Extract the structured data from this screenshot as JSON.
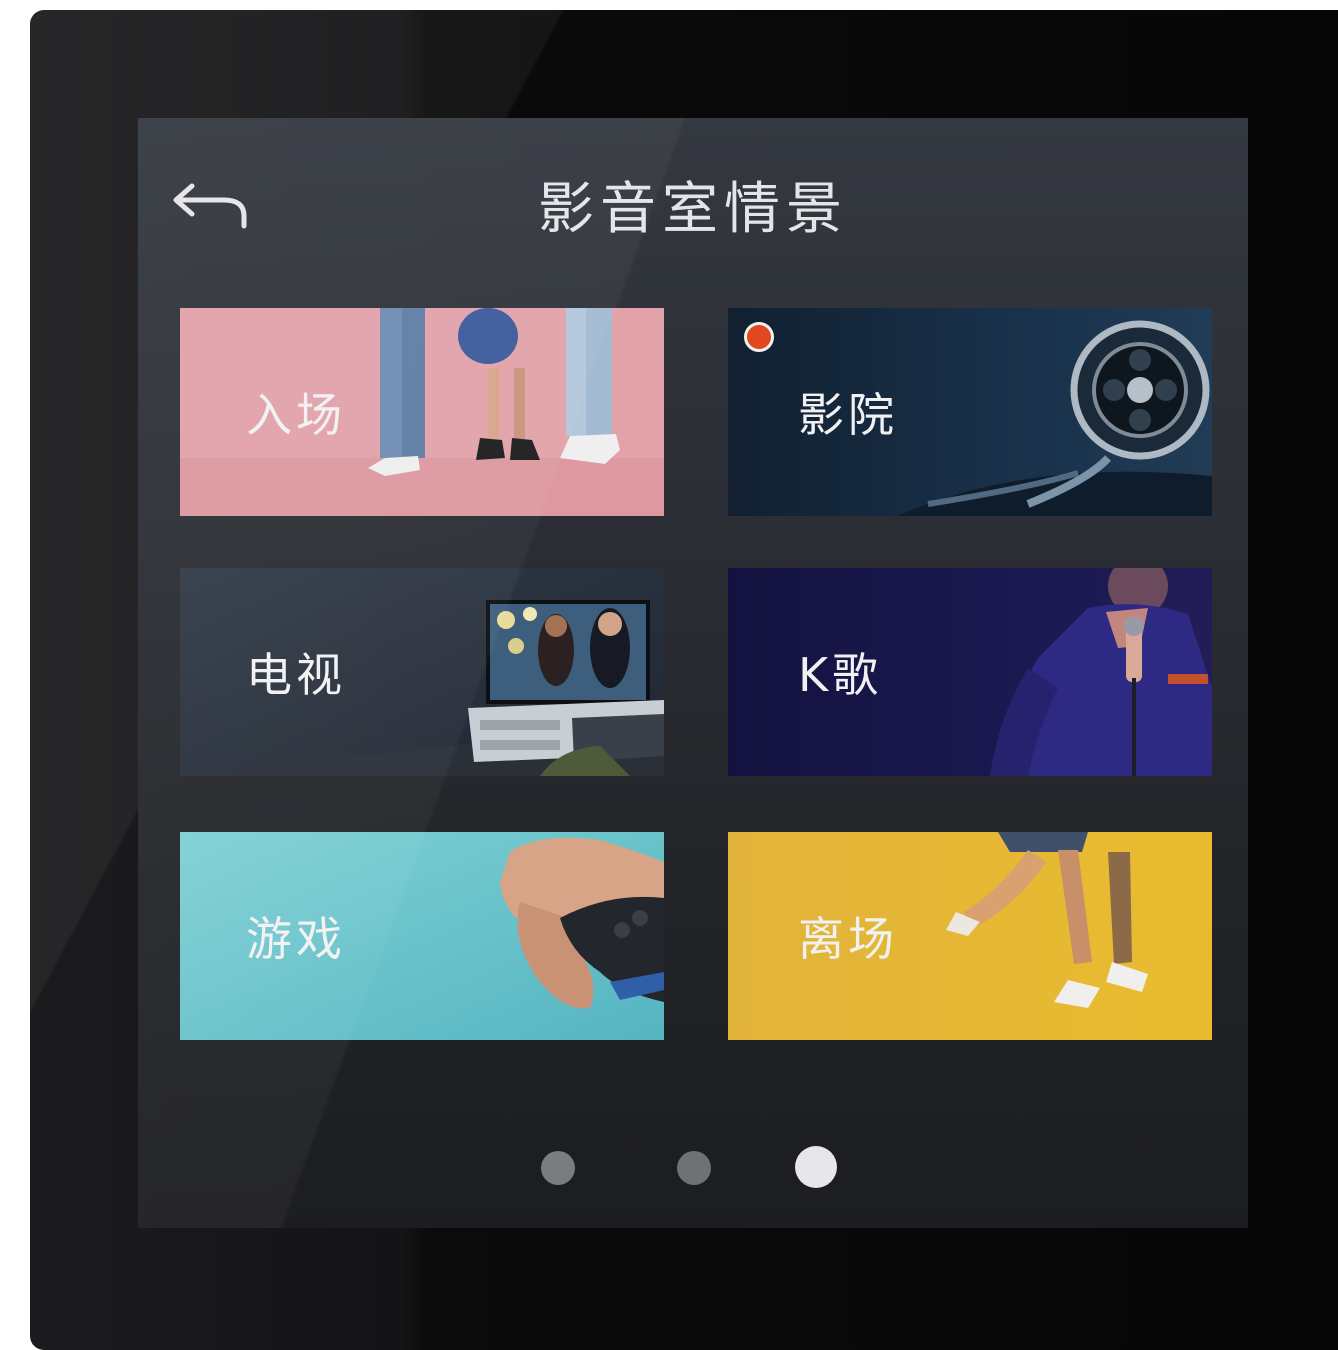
{
  "header": {
    "title": "影音室情景",
    "back_icon": "back-arrow-icon"
  },
  "scenes": [
    {
      "label": "入场",
      "color": "#e3a2aa",
      "active": false
    },
    {
      "label": "影院",
      "color": "#132233",
      "active": true,
      "active_color": "#e2481f"
    },
    {
      "label": "电视",
      "color": "#28303d",
      "active": false
    },
    {
      "label": "K歌",
      "color": "#151449",
      "active": false
    },
    {
      "label": "游戏",
      "color": "#72c9cf",
      "active": false
    },
    {
      "label": "离场",
      "color": "#e4b733",
      "active": false
    }
  ],
  "pager": {
    "total": 3,
    "current": 3
  }
}
